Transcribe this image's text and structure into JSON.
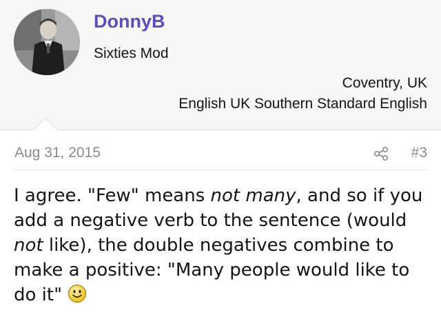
{
  "user": {
    "name": "DonnyB",
    "title": "Sixties Mod",
    "location": "Coventry, UK",
    "language": "English UK Southern Standard English",
    "avatar_icon": "user-avatar-photo"
  },
  "post": {
    "date": "Aug 31, 2015",
    "number": "#3",
    "share_icon": "share-icon",
    "body": {
      "p1": "I agree. \"Few\" means ",
      "p1_em": "not many",
      "p2": ", and so if you add a negative verb to the sentence (would ",
      "p2_em": "not",
      "p3": " like), the double negatives combine to make a positive: \"Many people would like to do it\"",
      "emoji_icon": "smiley-icon"
    }
  },
  "colors": {
    "username": "#5b4fb5",
    "card_bg": "#f6f6f6",
    "meta_text": "#8a8a8a"
  }
}
